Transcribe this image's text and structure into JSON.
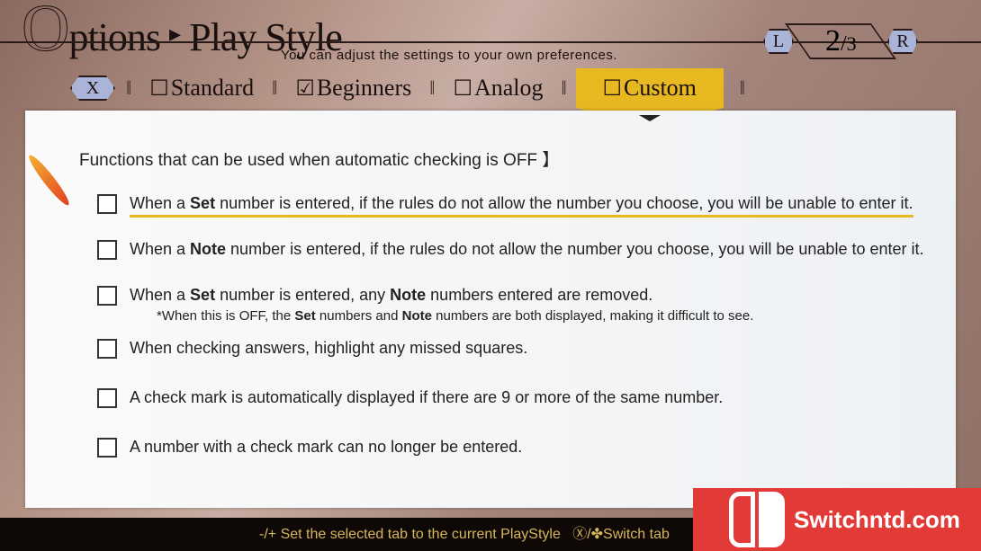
{
  "header": {
    "title_initial": "O",
    "title_rest": "ptions",
    "title_arrow": "▸",
    "title_page": "Play Style",
    "subtitle": "You can adjust the settings to your own preferences."
  },
  "pager": {
    "left_button": "L",
    "current": "2",
    "separator": "/",
    "total": "3",
    "right_button": "R"
  },
  "tabs": {
    "prev_button": "X",
    "items": [
      {
        "label": "Standard",
        "checked": false
      },
      {
        "label": "Beginners",
        "checked": true
      },
      {
        "label": "Analog",
        "checked": false
      },
      {
        "label": "Custom",
        "checked": false,
        "active": true
      }
    ]
  },
  "panel": {
    "heading": "Functions that can be used when automatic checking is OFF 】",
    "options": [
      {
        "checked": false,
        "selected": true,
        "parts": [
          "When a ",
          "Set",
          " number is entered, if the rules do not allow the number you choose, you will be unable to enter it."
        ]
      },
      {
        "checked": false,
        "parts": [
          "When a ",
          "Note",
          " number is entered, if the rules do not allow the number you choose, you will be unable to enter it."
        ]
      },
      {
        "checked": false,
        "parts": [
          "When a ",
          "Set",
          " number is entered, any ",
          "Note",
          " numbers entered are removed."
        ],
        "note": [
          "*When this is OFF, the ",
          "Set",
          " numbers and ",
          "Note",
          " numbers are both displayed, making it difficult to see."
        ]
      },
      {
        "checked": false,
        "parts": [
          "When checking answers, highlight any missed squares."
        ]
      },
      {
        "checked": false,
        "parts": [
          "A check mark is automatically displayed if there are 9 or more of the same number."
        ]
      },
      {
        "checked": false,
        "parts": [
          "A number with a check mark can no longer be entered."
        ]
      }
    ]
  },
  "footer": {
    "hint1": "-/+ Set the selected tab to the current PlayStyle",
    "hint2": "Ⓧ/✤Switch tab"
  },
  "watermark": {
    "text": "Switchntd.com"
  },
  "colors": {
    "accent": "#e8b820",
    "button": "#a9b4d8",
    "footer_text": "#d8b65a"
  }
}
